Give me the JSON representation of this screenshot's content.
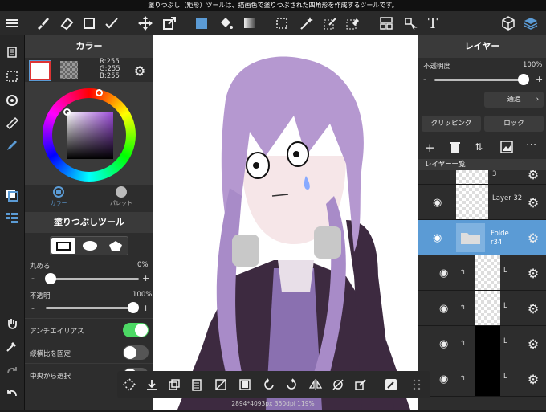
{
  "status": {
    "hint": "塗りつぶし（矩形）ツールは、描画色で塗りつぶされた四角形を作成するツールです。"
  },
  "toolbar": {
    "text_tool_glyph": "T"
  },
  "color_panel": {
    "title": "カラー",
    "rgb_r": "R:255",
    "rgb_g": "G:255",
    "rgb_b": "B:255",
    "tab_color": "カラー",
    "tab_palette": "パレット",
    "tool_title": "塗りつぶしツール",
    "round_label": "丸める",
    "round_value": "0%",
    "opacity_label": "不透明",
    "opacity_value": "100%",
    "minus": "-",
    "plus": "+",
    "antialias_label": "アンチエイリアス",
    "fix_ratio_label": "縦横比を固定",
    "from_center_label": "中央から選択",
    "toggles": {
      "antialias": true,
      "fix_ratio": false,
      "from_center": false
    }
  },
  "layer_panel": {
    "title": "レイヤー",
    "opacity_label": "不透明度",
    "opacity_value": "100%",
    "minus": "-",
    "plus": "+",
    "blend_mode": "通過",
    "clipping_label": "クリッピング",
    "lock_label": "ロック",
    "list_title": "レイヤー一覧",
    "layers": [
      {
        "name": "3"
      },
      {
        "name": "Layer 32"
      },
      {
        "name": "Folde r34"
      },
      {
        "name": "L"
      },
      {
        "name": "L"
      },
      {
        "name": "L"
      },
      {
        "name": "L"
      }
    ]
  },
  "canvas": {
    "info": "2894*4093px 350dpi 119%"
  },
  "colors": {
    "accent": "#5b9bd5",
    "toggle_on": "#4cd964",
    "selected_layer": "#5b9bd5"
  }
}
